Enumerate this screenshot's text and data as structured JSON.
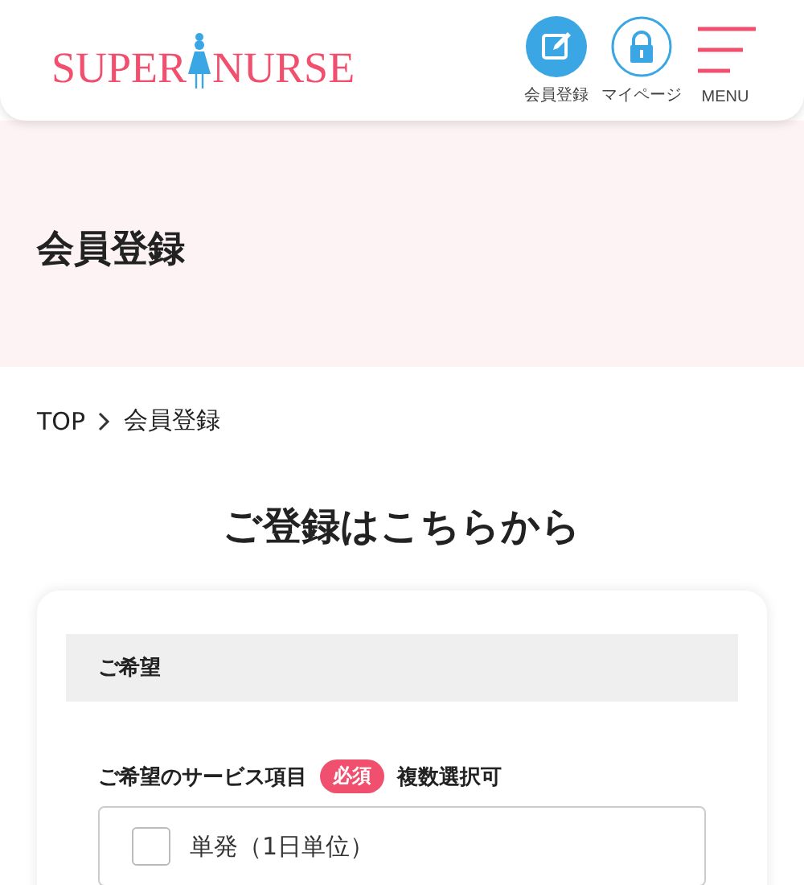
{
  "header": {
    "logo": {
      "left": "SUPER",
      "right": "NURSE"
    },
    "actions": [
      {
        "kind": "signup",
        "label": "会員登録"
      },
      {
        "kind": "mypage",
        "label": "マイページ"
      },
      {
        "kind": "menu",
        "label": "MENU"
      }
    ]
  },
  "hero": {
    "title": "会員登録"
  },
  "breadcrumb": [
    "TOP",
    "会員登録"
  ],
  "heading": "ご登録はこちらから",
  "form": {
    "section": "ご希望",
    "field": {
      "label": "ご希望のサービス項目",
      "badge": "必須",
      "note": "複数選択可",
      "options": [
        {
          "label": "単発（1日単位）",
          "checked": false
        }
      ]
    }
  }
}
